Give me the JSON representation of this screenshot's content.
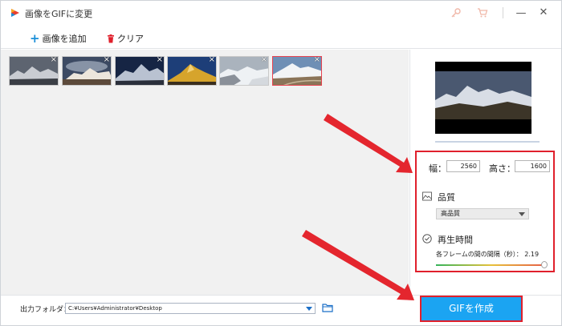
{
  "window": {
    "title": "画像をGIFに変更",
    "controls": {
      "minimize": "—",
      "close": "✕"
    }
  },
  "toolbar": {
    "add_label": "画像を追加",
    "clear_label": "クリア"
  },
  "thumbnails": [
    {
      "name": "dark-mountain",
      "selected": false
    },
    {
      "name": "cloudy-ridge",
      "selected": false
    },
    {
      "name": "night-peaks",
      "selected": false
    },
    {
      "name": "golden-peak",
      "selected": false
    },
    {
      "name": "snow-field",
      "selected": false
    },
    {
      "name": "valley-road",
      "selected": true
    }
  ],
  "thumb_close": "×",
  "settings": {
    "width_label": "幅：",
    "width_value": "2560",
    "height_label": "高さ：",
    "height_value": "1600",
    "quality_title": "品質",
    "quality_selected": "高品質",
    "time_title": "再生時間",
    "interval_label": "各フレームの間の間隔（秒）： 2.19"
  },
  "bottom": {
    "output_label": "出力フォルダ：",
    "output_path": "C:¥Users¥Administrator¥Desktop",
    "create_button": "GIFを作成"
  },
  "colors": {
    "accent": "#1ba4f2",
    "highlight_red": "#e0202c",
    "add_plus": "#1a8fd8",
    "clear_icon": "#e0202c"
  }
}
